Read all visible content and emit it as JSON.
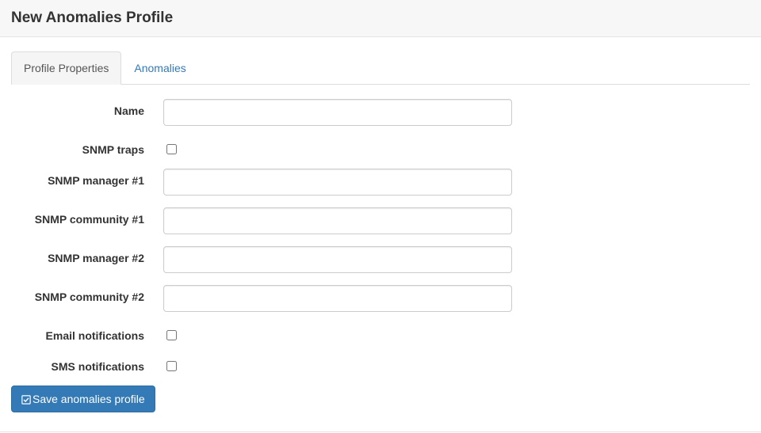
{
  "header": {
    "title": "New Anomalies Profile"
  },
  "tabs": {
    "properties": "Profile Properties",
    "anomalies": "Anomalies"
  },
  "form": {
    "labels": {
      "name": "Name",
      "snmp_traps": "SNMP traps",
      "snmp_mgr_1": "SNMP manager #1",
      "snmp_comm_1": "SNMP community #1",
      "snmp_mgr_2": "SNMP manager #2",
      "snmp_comm_2": "SNMP community #2",
      "email_notif": "Email notifications",
      "sms_notif": "SMS notifications"
    },
    "values": {
      "name": "",
      "snmp_mgr_1": "",
      "snmp_comm_1": "",
      "snmp_mgr_2": "",
      "snmp_comm_2": ""
    }
  },
  "buttons": {
    "save": "Save anomalies profile"
  }
}
